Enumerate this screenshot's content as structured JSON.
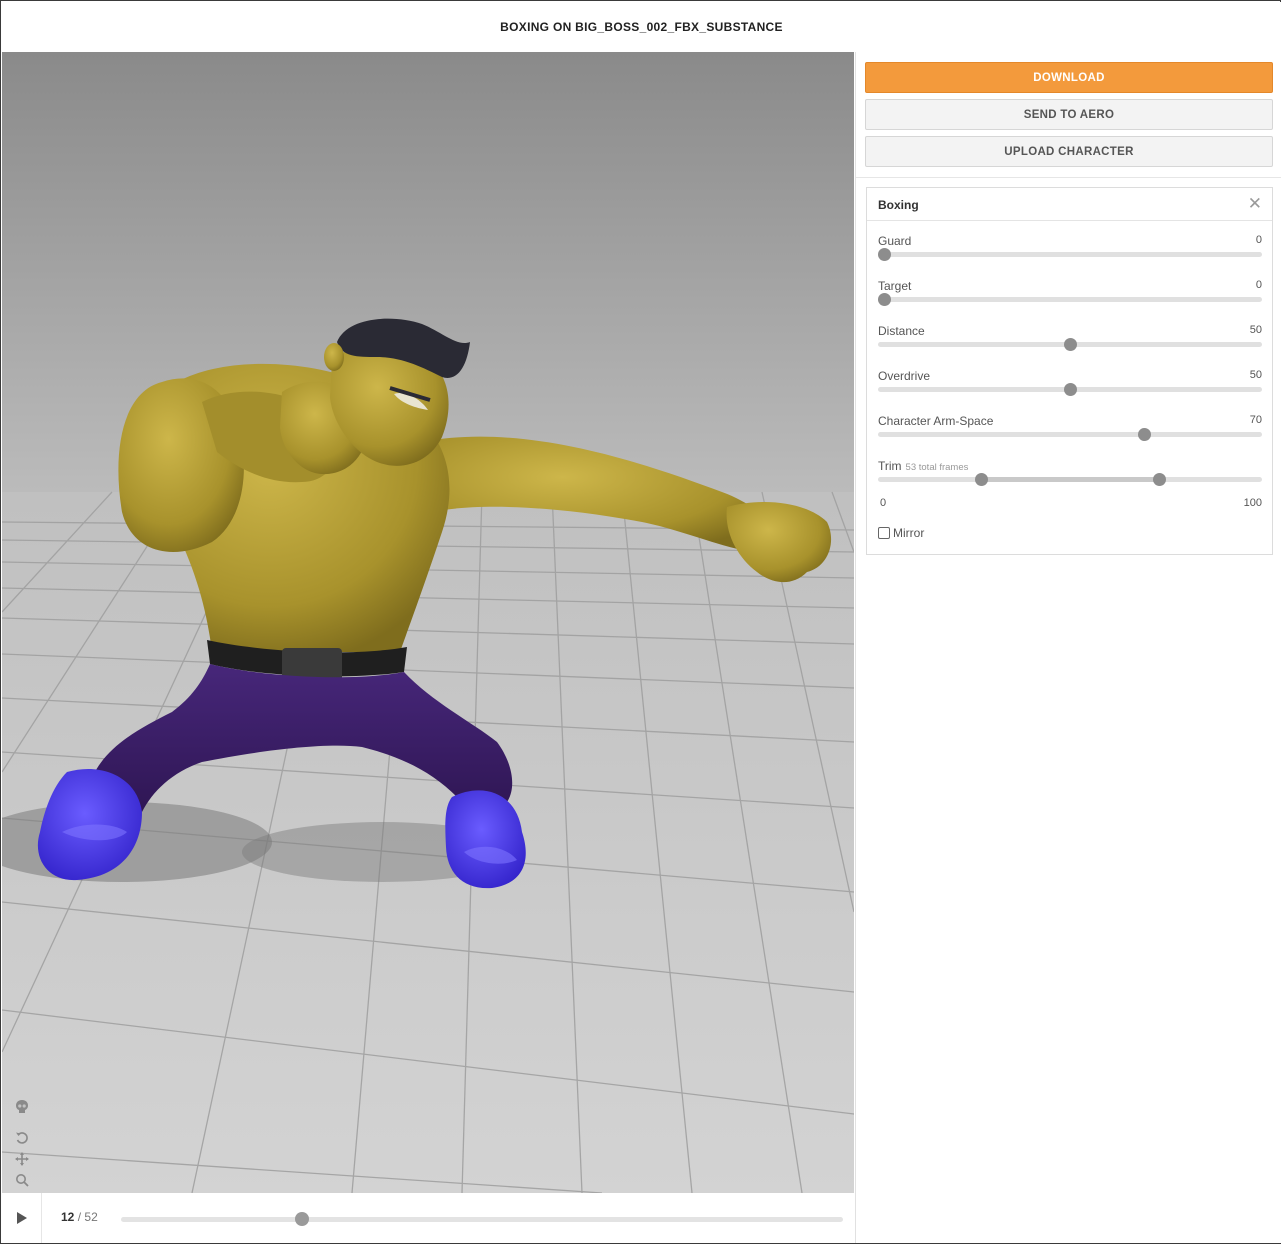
{
  "header": {
    "title": "BOXING ON BIG_BOSS_002_FBX_SUBSTANCE"
  },
  "actions": {
    "download": "DOWNLOAD",
    "send_to_aero": "SEND TO AERO",
    "upload_character": "UPLOAD CHARACTER"
  },
  "panel": {
    "title": "Boxing",
    "close_icon": "close-icon",
    "params": [
      {
        "label": "Guard",
        "value": "0",
        "level": 0
      },
      {
        "label": "Target",
        "value": "0",
        "level": 0
      },
      {
        "label": "Distance",
        "value": "50",
        "level": 0.5
      },
      {
        "label": "Overdrive",
        "value": "50",
        "level": 0.5
      },
      {
        "label": "Character Arm-Space",
        "value": "70",
        "level": 0.7
      }
    ],
    "trim": {
      "label": "Trim",
      "sublabel": "53 total frames",
      "min": "0",
      "max": "100",
      "range_start": 0.26,
      "range_end": 0.74
    },
    "mirror": {
      "label": "Mirror",
      "checked": false
    }
  },
  "player": {
    "current_frame": "12",
    "separator": "/",
    "total_frames": "52",
    "progress": 0.25
  },
  "toolbar_icons": [
    "skeleton-icon",
    "reset-icon",
    "move-icon",
    "zoom-icon",
    "power-icon",
    "camera-icon"
  ],
  "colors": {
    "accent": "#f39a3c",
    "skin": "#b9a236",
    "pants": "#3c2064",
    "shoes": "#4433e0",
    "hair": "#2a2a34",
    "floor": "#c8c8c8"
  }
}
